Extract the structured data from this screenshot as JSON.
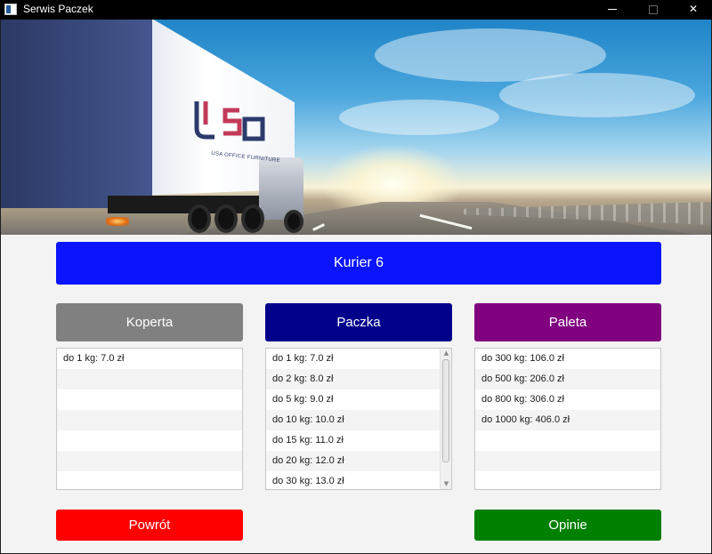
{
  "window": {
    "title": "Serwis Paczek",
    "minimize_icon": "minimize-icon",
    "maximize_icon": "maximize-icon",
    "close_icon": "close-icon",
    "close_glyph": "✕"
  },
  "banner": {
    "logo_text": "USA OFFICE FURNITURE",
    "logo_letters": "USO"
  },
  "courier": {
    "label": "Kurier 6",
    "color": "#0a14ff"
  },
  "categories": [
    {
      "label": "Koperta",
      "color": "#808080",
      "items": [
        "do 1 kg: 7.0 zł"
      ]
    },
    {
      "label": "Paczka",
      "color": "#00008b",
      "items": [
        "do 1 kg: 7.0 zł",
        "do 2 kg: 8.0 zł",
        "do 5 kg: 9.0 zł",
        "do 10 kg: 10.0 zł",
        "do 15 kg: 11.0 zł",
        "do 20 kg: 12.0 zł",
        "do 30 kg: 13.0 zł"
      ]
    },
    {
      "label": "Paleta",
      "color": "#800080",
      "items": [
        "do 300 kg: 106.0 zł",
        "do 500 kg: 206.0 zł",
        "do 800 kg: 306.0 zł",
        "do 1000 kg: 406.0 zł"
      ]
    }
  ],
  "actions": {
    "back_label": "Powrót",
    "back_color": "#ff0000",
    "reviews_label": "Opinie",
    "reviews_color": "#008000"
  }
}
